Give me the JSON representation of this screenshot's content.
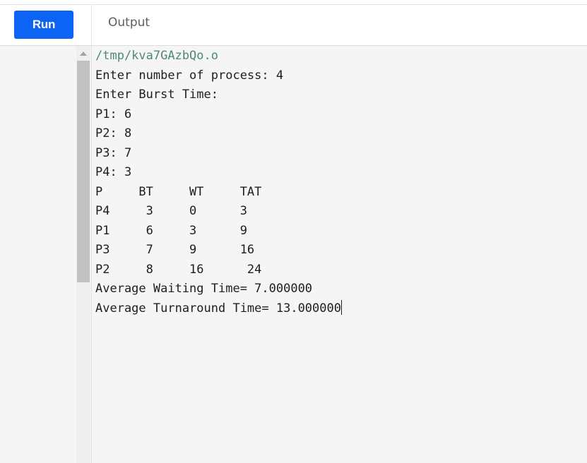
{
  "toolbar": {
    "run_label": "Run",
    "output_tab_label": "Output"
  },
  "colors": {
    "run_button": "#0d63f3",
    "path_text": "#4f8a6e",
    "console_text": "#1e1e1e",
    "background": "#f5f5f5"
  },
  "console": {
    "path": "/tmp/kva7GAzbQo.o",
    "lines": [
      "Enter number of process: 4",
      "Enter Burst Time:",
      "P1: 6",
      "P2: 8",
      "P3: 7",
      "P4: 3",
      "P     BT     WT     TAT",
      "P4     3     0      3",
      "P1     6     3      9",
      "P3     7     9      16",
      "P2     8     16      24",
      "Average Waiting Time= 7.000000",
      "Average Turnaround Time= 13.000000"
    ]
  }
}
